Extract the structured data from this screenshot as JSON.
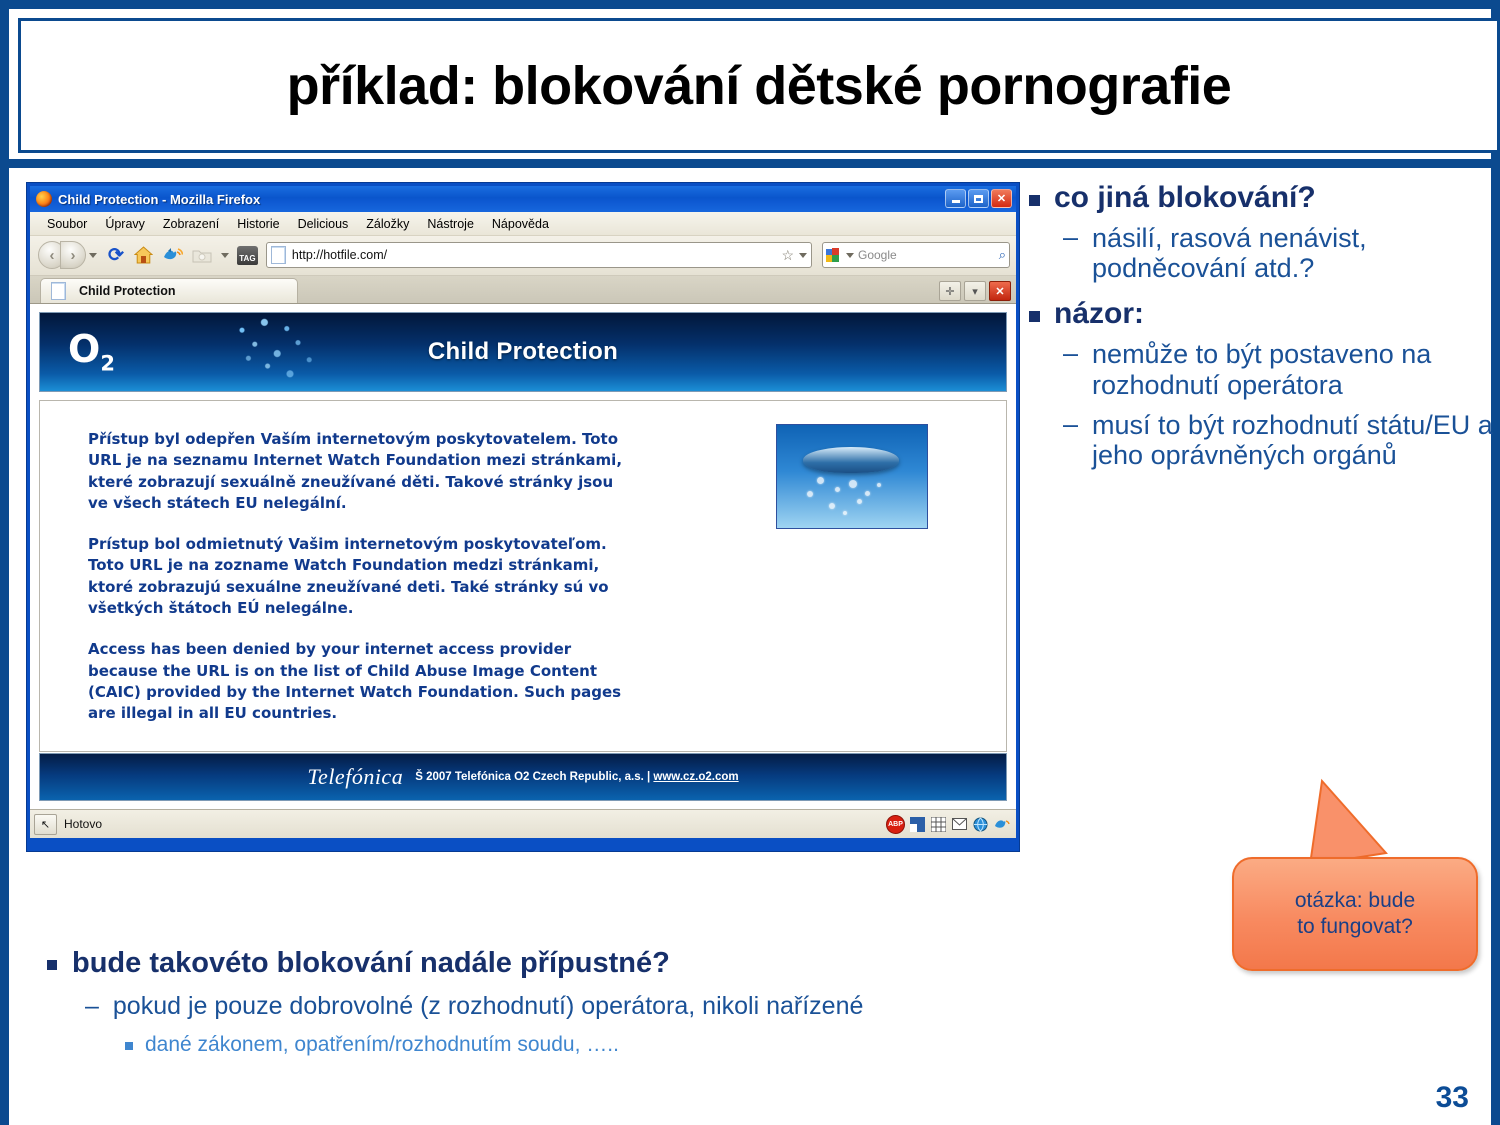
{
  "slide": {
    "title": "příklad: blokování dětské pornografie",
    "page_number": "33",
    "accent_color": "#0b4a8f",
    "bullet_color": "#17306b",
    "sub_bullet_color": "#1a5197",
    "callout_color": "#f8855a"
  },
  "browser": {
    "window_title": "Child Protection - Mozilla Firefox",
    "window_buttons": {
      "minimize": "_",
      "maximize": "□",
      "close": "✕"
    },
    "menu": [
      "Soubor",
      "Úpravy",
      "Zobrazení",
      "Historie",
      "Delicious",
      "Záložky",
      "Nástroje",
      "Nápověda"
    ],
    "toolbar": {
      "back": "‹",
      "forward": "›",
      "reload": "⟳",
      "home": "⌂",
      "bird": "🐦",
      "folder": "🗀",
      "tag_label": "TAG",
      "star": "☆"
    },
    "url": "http://hotfile.com/",
    "search_placeholder": "Google",
    "tab_title": "Child Protection",
    "tab_controls": {
      "move": "✛",
      "dropdown": "▾",
      "close": "✕"
    },
    "status": "Hotovo",
    "status_icons": [
      "ABP",
      "panel-icon",
      "grid-icon",
      "mail-icon",
      "globe-icon",
      "bird-icon"
    ]
  },
  "page": {
    "logo": "O",
    "logo_sub": "2",
    "banner_title": "Child Protection",
    "paragraph_cs": "Přístup byl odepřen Vaším internetovým poskytovatelem. Toto URL je na seznamu Internet Watch Foundation mezi stránkami, které zobrazují sexuálně zneužívané děti. Takové stránky jsou ve všech státech EU nelegální.",
    "paragraph_sk": "Prístup bol odmietnutý Vašim internetovým poskytovateľom. Toto URL je na zozname Watch Foundation medzi stránkami, ktoré zobrazujú sexuálne zneužívané deti. Také stránky sú vo všetkých štátoch EÚ nelegálne.",
    "paragraph_en": "Access has been denied by your internet access provider because the URL is on the list of Child Abuse Image Content (CAIC) provided by the Internet Watch Foundation. Such pages are illegal in all EU countries.",
    "footer_brand": "Telefónica",
    "footer_copy": "Š 2007 Telefónica O2 Czech Republic, a.s. | ",
    "footer_link": "www.cz.o2.com"
  },
  "right_column": {
    "bullet1": "co jiná blokování?",
    "bullet1_sub": [
      "násilí, rasová nenávist, podněcování atd.?"
    ],
    "bullet2": "názor:",
    "bullet2_sub": [
      "nemůže to být postaveno na rozhodnutí operátora",
      "musí to být rozhodnutí státu/EU a jeho oprávněných orgánů"
    ],
    "dash": "–"
  },
  "callout": {
    "line1": "otázka: bude",
    "line2": "to fungovat?"
  },
  "bottom": {
    "bullet1": "bude takovéto blokování nadále přípustné?",
    "bullet2": "pokud je pouze dobrovolné (z rozhodnutí) operátora, nikoli nařízené",
    "bullet3": "dané zákonem, opatřením/rozhodnutím soudu, …..",
    "dash": "–"
  }
}
